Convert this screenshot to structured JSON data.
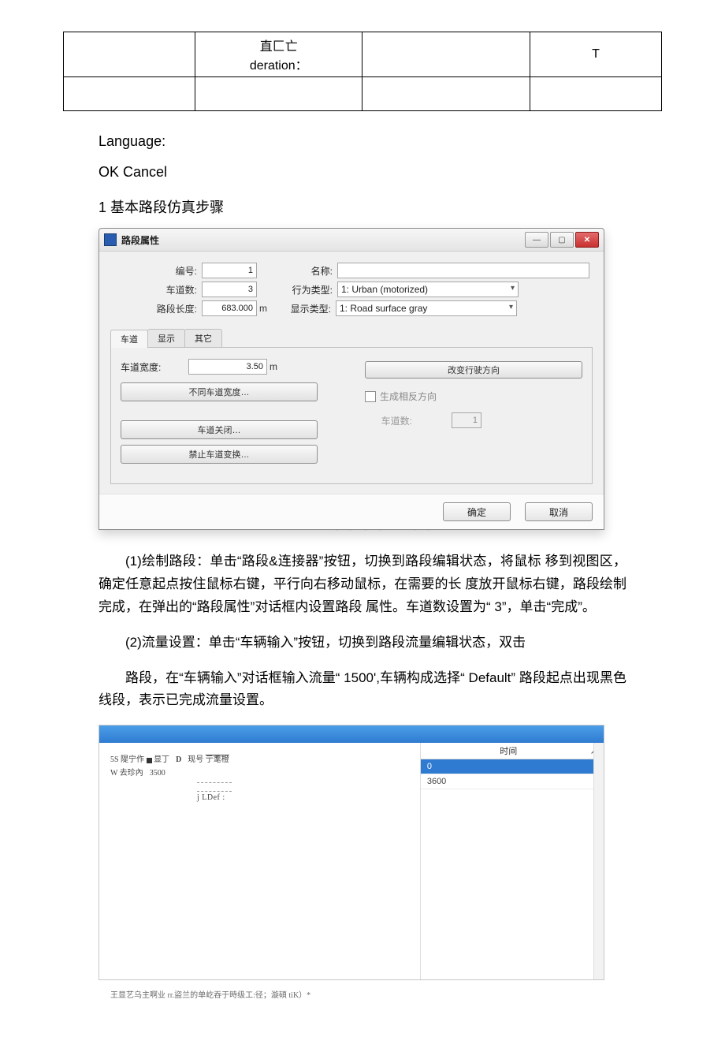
{
  "top_table": {
    "row1": {
      "c1": "直匚亡\nderation：",
      "c3": "T"
    }
  },
  "lines": {
    "language": "Language:",
    "okcancel": "OK Cancel"
  },
  "heading1": "1 基本路段仿真步骤",
  "dialog1": {
    "title": "路段属性",
    "win_min": "—",
    "win_max": "▢",
    "win_close": "✕",
    "lbl_id": "编号:",
    "val_id": "1",
    "lbl_name": "名称:",
    "val_name": "",
    "lbl_lanes": "车道数:",
    "val_lanes": "3",
    "lbl_behavior": "行为类型:",
    "val_behavior": "1: Urban (motorized)",
    "lbl_length": "路段长度:",
    "val_length": "683.000",
    "unit_m": "m",
    "lbl_display": "显示类型:",
    "val_display": "1: Road surface gray",
    "tabs": {
      "t1": "车道",
      "t2": "显示",
      "t3": "其它"
    },
    "lbl_lane_width": "车道宽度:",
    "val_lane_width": "3.50",
    "btn_diff_width": "不同车道宽度…",
    "btn_lane_close": "车道关闭…",
    "btn_no_change": "禁止车道变换…",
    "btn_reverse": "改变行驶方向",
    "chk_opposite": "生成相反方向",
    "lbl_opp_lanes": "车道数:",
    "val_opp_lanes": "1",
    "btn_ok": "确定",
    "btn_cancel": "取消"
  },
  "watermark": "www.bdocx.com",
  "para1": "(1)绘制路段：单击“路段&连接器”按钮，切换到路段编辑状态，将鼠标 移到视图区，确定任意起点按住鼠标右键，平行向右移动鼠标，在需要的长 度放开鼠标右键，路段绘制完成，在弹出的“路段属性”对话框内设置路段 属性。车道数设置为“ 3”，单击“完成”。",
  "para2": "(2)流量设置：单击“车辆输入”按钮，切换到路段流量编辑状态，双击",
  "para3": "路段，在“车辆输入”对话框输入流量“ 1500',车辆构成选择“ Default” 路段起点出现黑色线段，表示已完成流量设置。",
  "dialog2": {
    "left_l1a": "5S 隄宁作",
    "left_l1b": "显丁",
    "left_l1c": "D",
    "left_l1d": "现号",
    "left_l1e": "亍耄橙",
    "left_l2a": "W 去珍內",
    "left_l2b": "3500",
    "src_label": "·.-·.-·",
    "ldef": "j LDef :",
    "col_time": "时间",
    "row_sel": "0",
    "row_3600": "3600"
  },
  "footnote": "王显艺乌主啊业 rr.盜兰的单屹吞于時级工:径；漩碩 tiK）*"
}
